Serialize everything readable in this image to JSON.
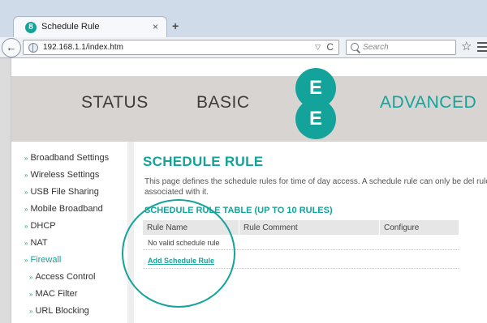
{
  "browser": {
    "tab_title": "Schedule Rule",
    "tab_logo": "8",
    "tab_close": "×",
    "new_tab": "+",
    "back": "←",
    "url": "192.168.1.1/index.htm",
    "url_dropdown": "▽",
    "reload": "C",
    "search_placeholder": "Search",
    "bookmark": "☆"
  },
  "header": {
    "nav": [
      "STATUS",
      "BASIC",
      "ADVANCED"
    ],
    "logo_letters": [
      "E",
      "E"
    ],
    "brand_color": "#14a39a"
  },
  "sidebar": {
    "arrow": "»",
    "items": [
      {
        "label": "Broadband Settings"
      },
      {
        "label": "Wireless Settings"
      },
      {
        "label": "USB File Sharing"
      },
      {
        "label": "Mobile Broadband"
      },
      {
        "label": "DHCP"
      },
      {
        "label": "NAT"
      },
      {
        "label": "Firewall"
      },
      {
        "label": "Access Control"
      },
      {
        "label": "MAC Filter"
      },
      {
        "label": "URL Blocking"
      }
    ]
  },
  "content": {
    "title": "SCHEDULE RULE",
    "description": "This page defines the schedule rules for time of day access. A schedule rule can only be del rule is associated with it.",
    "table_title": "SCHEDULE RULE TABLE (UP TO 10 RULES)",
    "columns": [
      "Rule Name",
      "Rule Comment",
      "Configure"
    ],
    "empty_message": "No valid schedule rule",
    "add_link": "Add Schedule Rule"
  }
}
